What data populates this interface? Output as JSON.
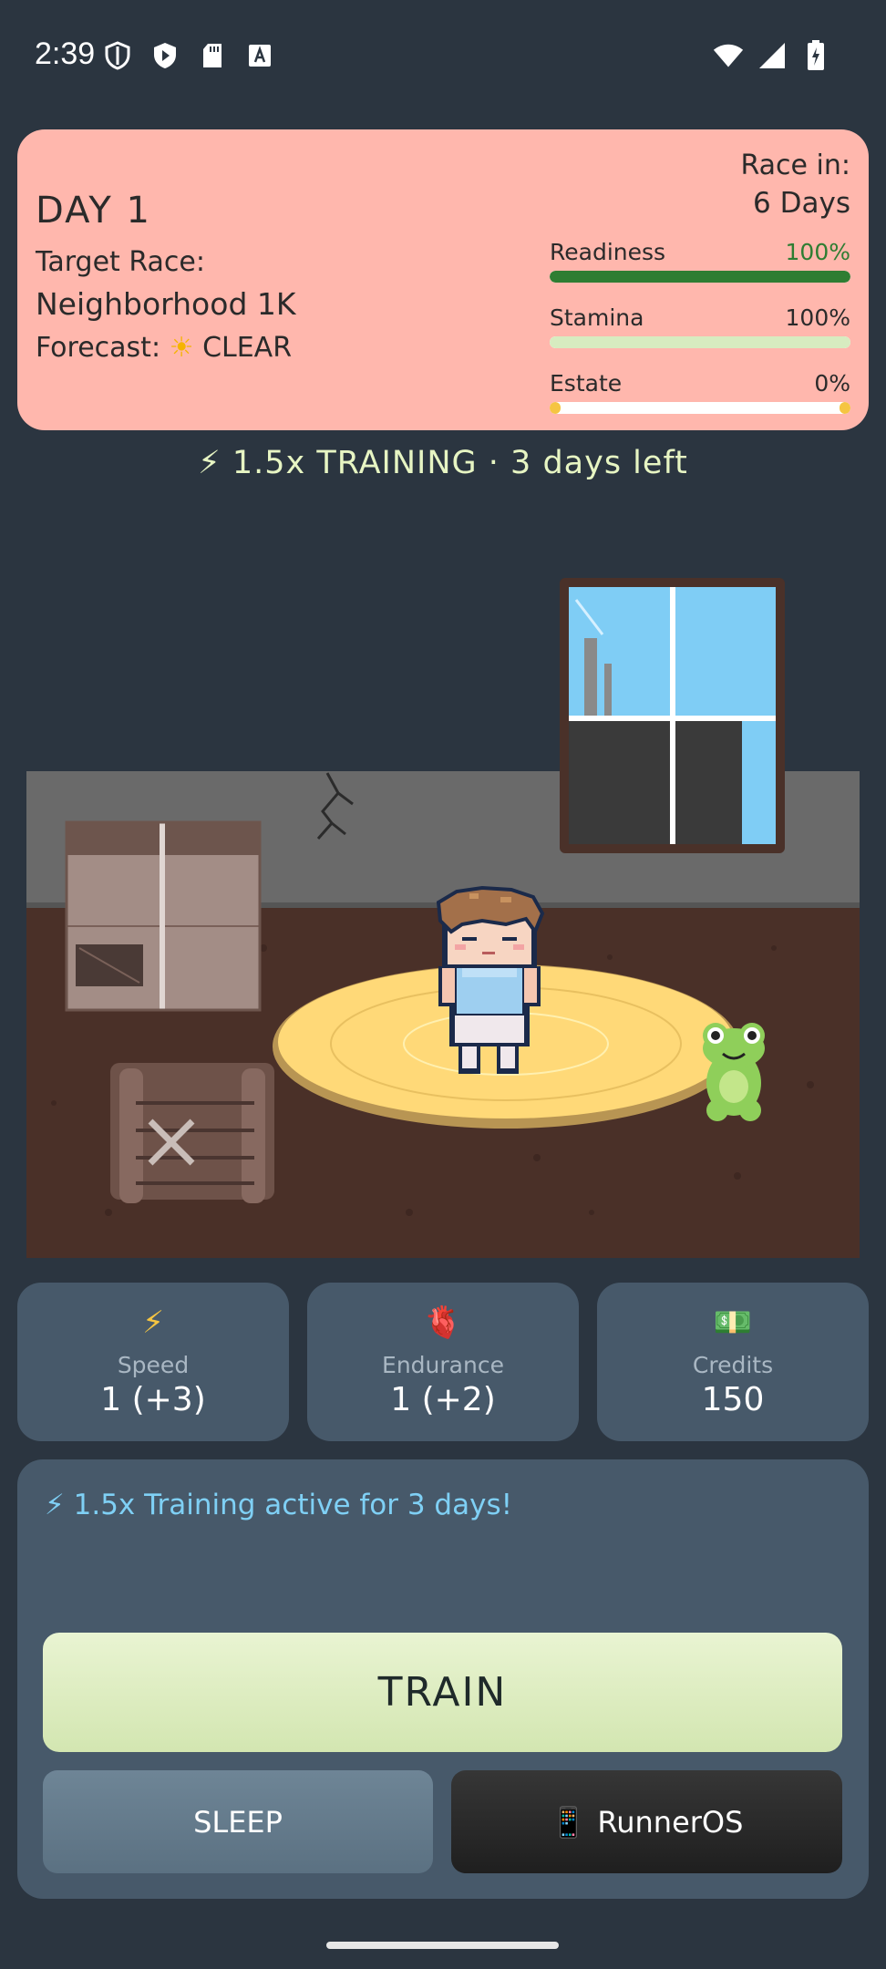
{
  "status_bar": {
    "time": "2:39",
    "left_icons": [
      "shield-icon",
      "play-shield-icon",
      "sd-card-icon",
      "font-icon"
    ],
    "right_icons": [
      "wifi-icon",
      "cellular-icon",
      "battery-charging-icon"
    ]
  },
  "header": {
    "day": "DAY 1",
    "target_label": "Target Race:",
    "target_race": "Neighborhood 1K",
    "forecast_label": "Forecast:",
    "forecast_icon": "sun-icon",
    "forecast_value": "CLEAR",
    "race_in_label": "Race in:",
    "race_in_value": "6 Days",
    "background": "#ffb7ad",
    "meters": [
      {
        "label": "Readiness",
        "value_text": "100%",
        "fraction": 1.0,
        "color": "#2e7d32"
      },
      {
        "label": "Stamina",
        "value_text": "100%",
        "fraction": 1.0,
        "color": "#d7ecc0"
      },
      {
        "label": "Estate",
        "value_text": "0%",
        "fraction": 0.0,
        "color": "#f5c542"
      }
    ]
  },
  "banner": "⚡ 1.5x TRAINING · 3 days left",
  "scene": {
    "description_icons": [
      "window-icon",
      "boxes-icon",
      "crate-icon",
      "runner-character",
      "frog-mascot",
      "wall-crack-icon",
      "training-mat"
    ]
  },
  "stats": [
    {
      "icon": "⚡",
      "label": "Speed",
      "value": "1 (+3)"
    },
    {
      "icon": "🫀",
      "label": "Endurance",
      "value": "1 (+2)"
    },
    {
      "icon": "💵",
      "label": "Credits",
      "value": "150"
    }
  ],
  "actions": {
    "active_message": "⚡ 1.5x Training active for 3 days!",
    "train_label": "TRAIN",
    "sleep_label": "SLEEP",
    "os_icon": "📱",
    "os_label": "RunnerOS"
  }
}
